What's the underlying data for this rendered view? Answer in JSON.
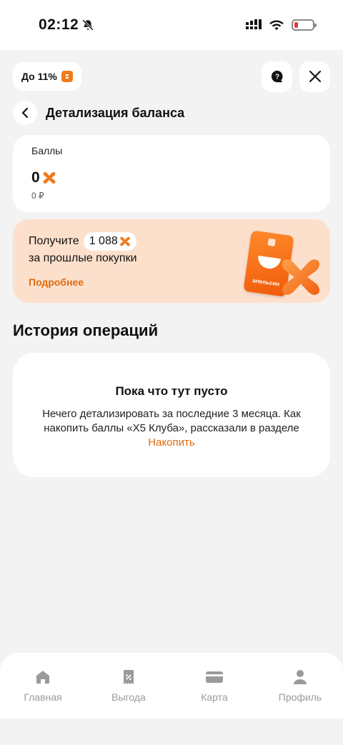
{
  "status_bar": {
    "time": "02:12"
  },
  "top": {
    "cashback_label": "До 11%"
  },
  "header": {
    "title": "Детализация баланса"
  },
  "balance": {
    "label": "Баллы",
    "value": "0",
    "rub": "0 ₽"
  },
  "promo": {
    "prefix": "Получите",
    "amount": "1 088",
    "subtitle": "за прошлые покупки",
    "link": "Подробнее",
    "card_brand": "апельсин"
  },
  "history": {
    "title": "История операций",
    "empty_title": "Пока что тут пусто",
    "empty_text": "Нечего детализировать за последние 3 месяца. Как накопить баллы «X5 Клуба», рассказали в разделе",
    "empty_link": "Накопить"
  },
  "nav": {
    "items": [
      {
        "label": "Главная",
        "icon": "home-icon"
      },
      {
        "label": "Выгода",
        "icon": "discount-icon"
      },
      {
        "label": "Карта",
        "icon": "card-icon"
      },
      {
        "label": "Профиль",
        "icon": "profile-icon"
      }
    ]
  },
  "colors": {
    "accent": "#f07a1c",
    "promo_bg": "#fde0cc",
    "bg": "#f3f3f3"
  }
}
